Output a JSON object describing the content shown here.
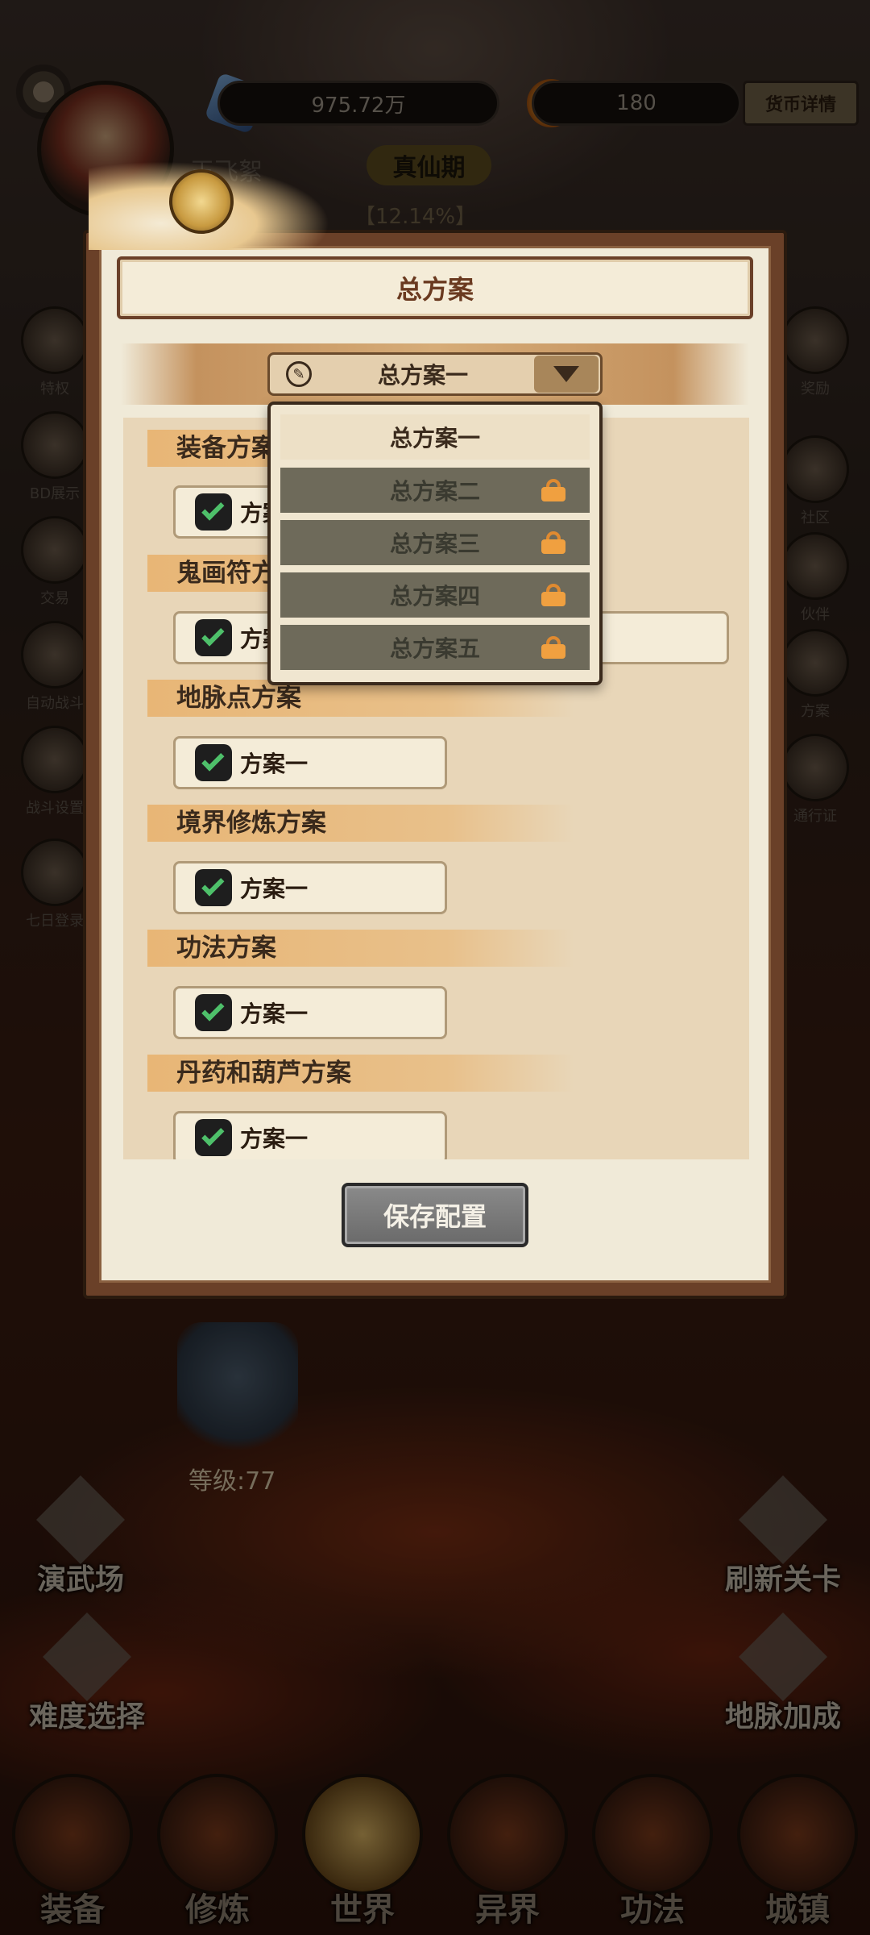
{
  "header": {
    "currency_primary": "975.72万",
    "currency_secondary": "180",
    "currency_detail_label": "货币详情",
    "player_name": "玉飞絮",
    "realm": "真仙期",
    "realm_progress": "【12.14%】"
  },
  "side_menu_left": [
    "特权",
    "BD展示",
    "交易",
    "自动战斗",
    "战斗设置",
    "七日登录"
  ],
  "side_menu_right": [
    "奖励",
    "社区",
    "伙伴",
    "方案",
    "通行证"
  ],
  "modal": {
    "title": "总方案",
    "selected_scheme": "总方案一",
    "dropdown_options": [
      {
        "label": "总方案一",
        "locked": false
      },
      {
        "label": "总方案二",
        "locked": true
      },
      {
        "label": "总方案三",
        "locked": true
      },
      {
        "label": "总方案四",
        "locked": true
      },
      {
        "label": "总方案五",
        "locked": true
      }
    ],
    "sections": [
      {
        "title": "装备方案",
        "value": "方案一"
      },
      {
        "title": "鬼画符方案",
        "value": "方案一"
      },
      {
        "title": "地脉点方案",
        "value": "方案一"
      },
      {
        "title": "境界修炼方案",
        "value": "方案一"
      },
      {
        "title": "功法方案",
        "value": "方案一"
      },
      {
        "title": "丹药和葫芦方案",
        "value": "方案一"
      }
    ],
    "save_label": "保存配置"
  },
  "scene": {
    "boss_level": "等级:77",
    "left_btn_1": "演武场",
    "left_btn_2": "难度选择",
    "right_btn_1": "刷新关卡",
    "right_btn_2": "地脉加成"
  },
  "bottom_nav": [
    "装备",
    "修炼",
    "世界",
    "异界",
    "功法",
    "城镇"
  ],
  "colors": {
    "modal_frame": "#6a4028",
    "modal_panel": "#f0ead8",
    "locked_option": "#6e6a5a",
    "lock_accent": "#f0a040",
    "check_green": "#4ec06a"
  }
}
